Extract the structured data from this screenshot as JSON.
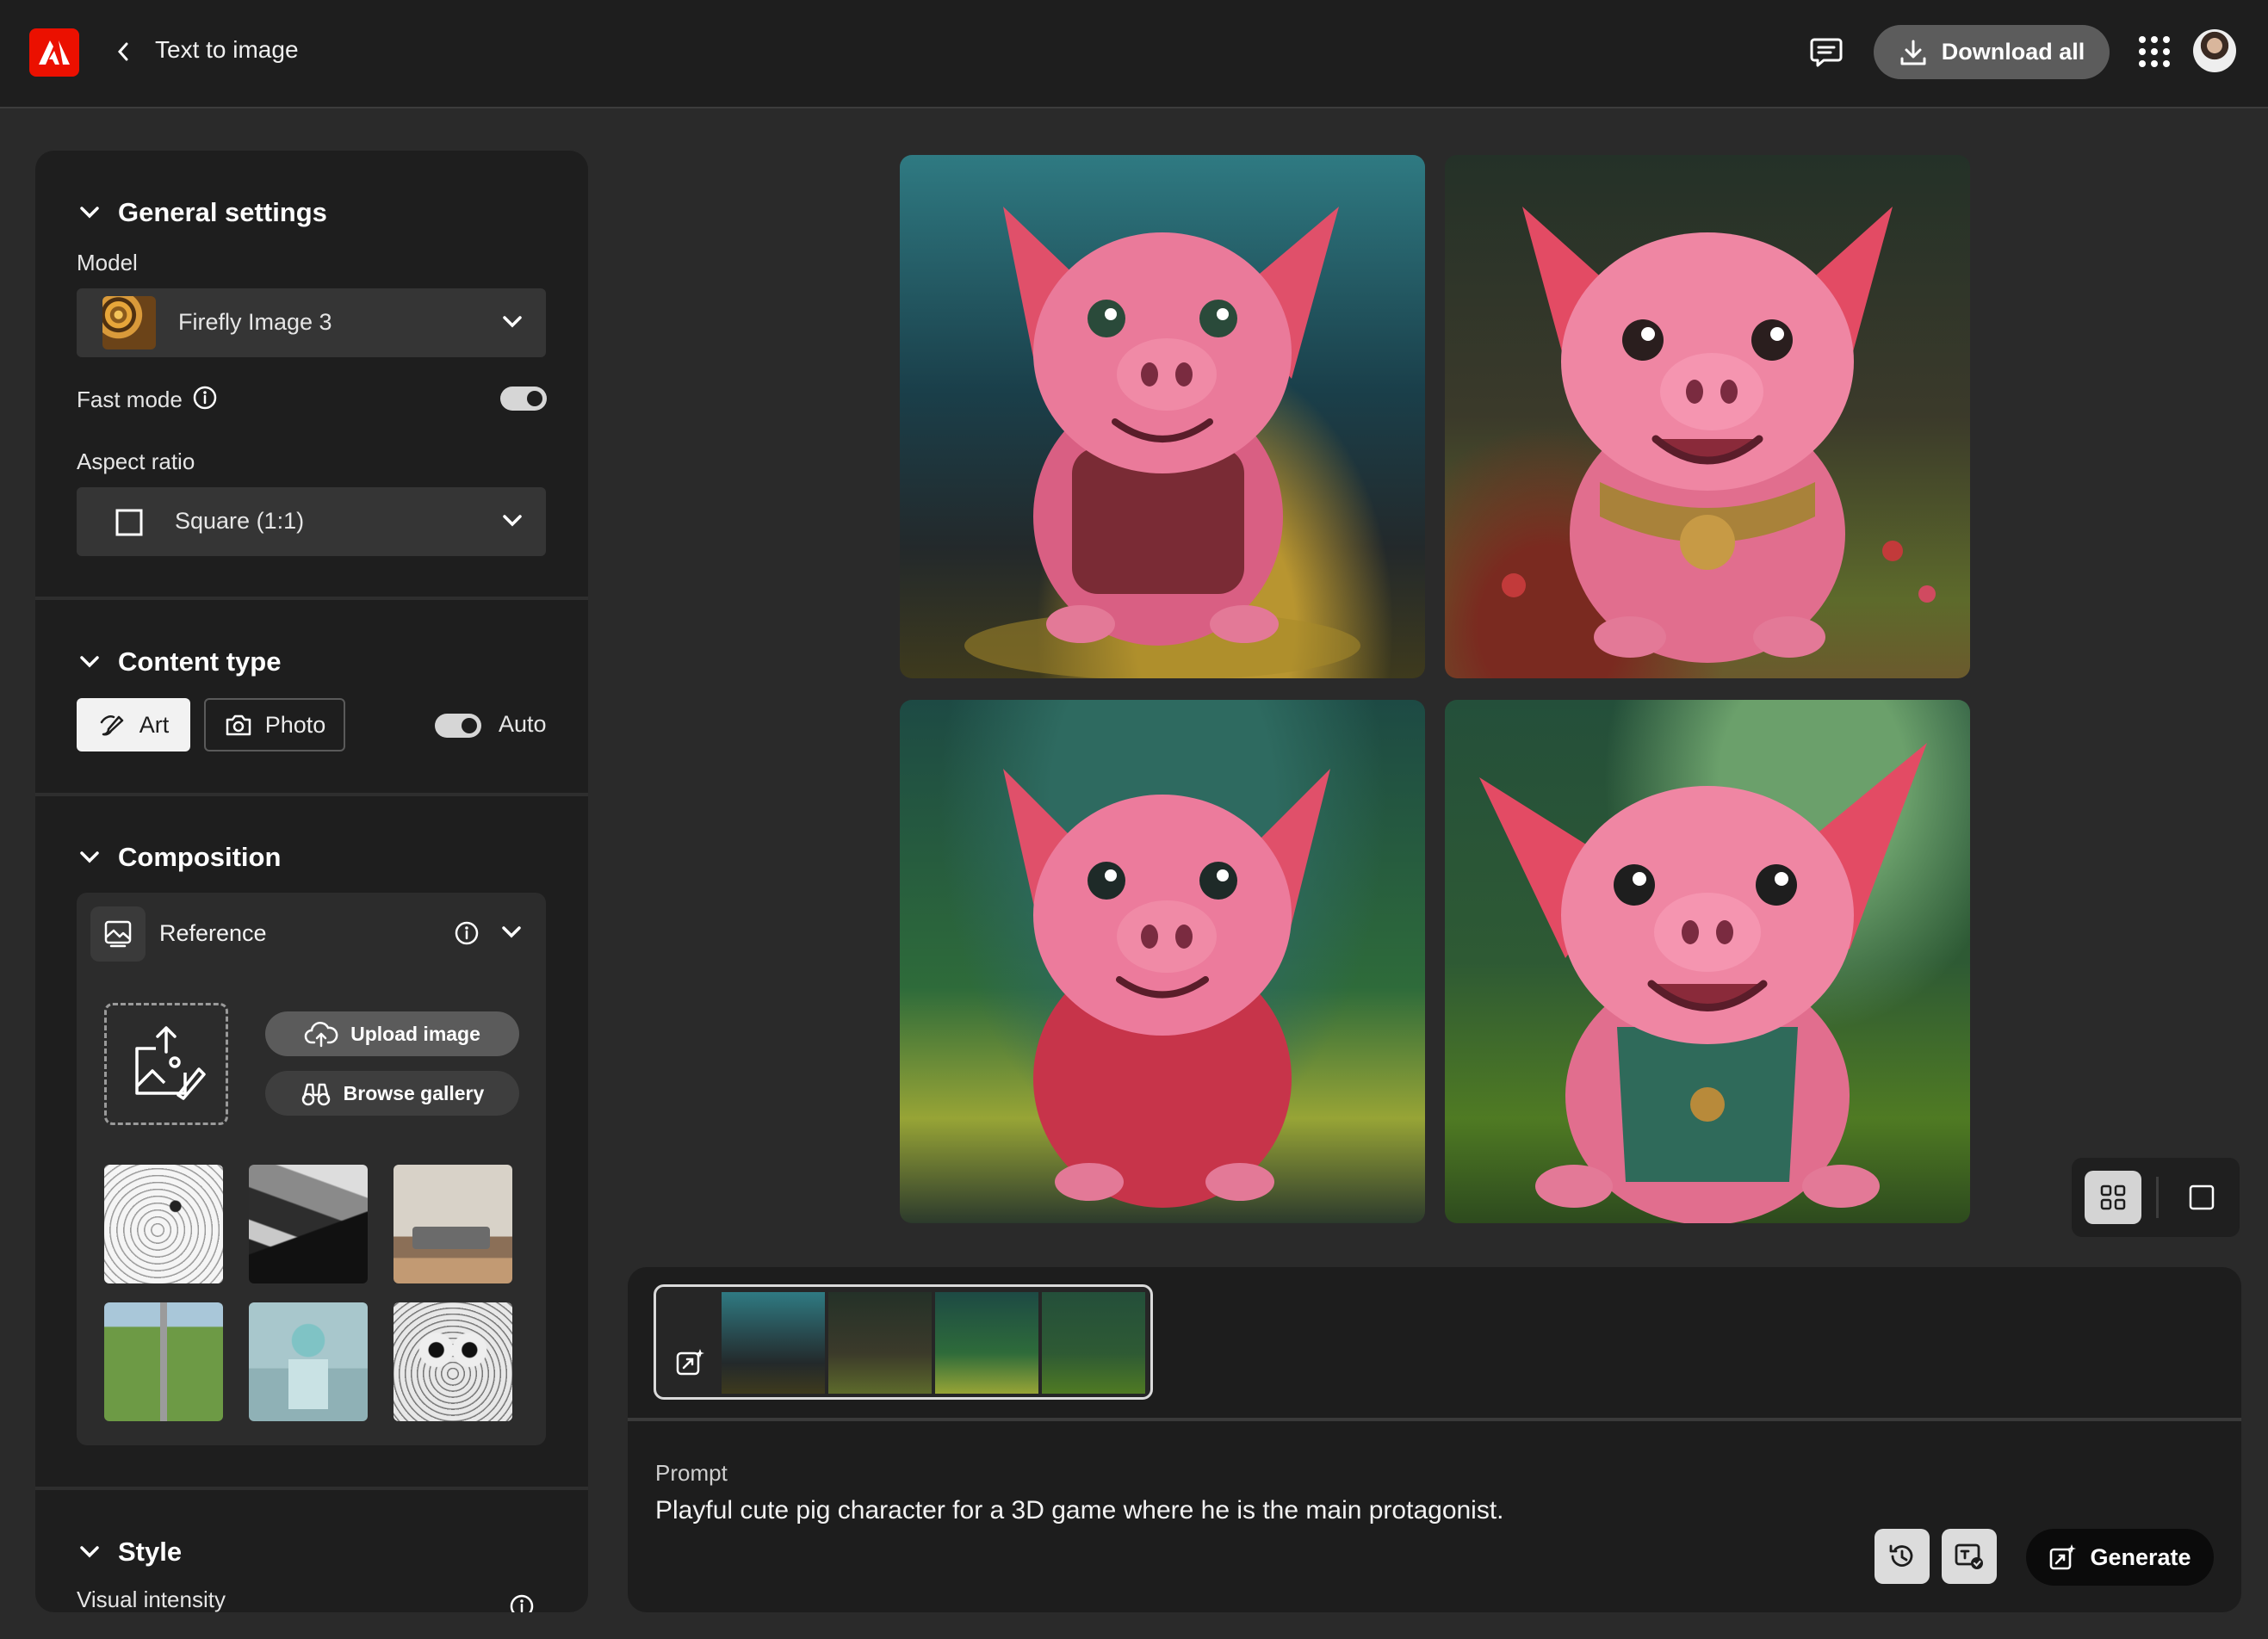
{
  "header": {
    "title": "Text to image",
    "download_label": "Download all"
  },
  "panel": {
    "general": {
      "title": "General settings",
      "model_label": "Model",
      "model_value": "Firefly Image 3",
      "fast_mode_label": "Fast mode",
      "fast_mode_on": true,
      "aspect_label": "Aspect ratio",
      "aspect_value": "Square (1:1)"
    },
    "content_type": {
      "title": "Content type",
      "art_label": "Art",
      "photo_label": "Photo",
      "auto_label": "Auto",
      "auto_on": true,
      "selected": "Art"
    },
    "composition": {
      "title": "Composition",
      "reference_label": "Reference",
      "upload_label": "Upload image",
      "browse_label": "Browse gallery"
    },
    "style": {
      "title": "Style",
      "visual_intensity_label": "Visual intensity"
    }
  },
  "view": {
    "mode": "grid"
  },
  "prompt": {
    "label": "Prompt",
    "text": "Playful cute pig character for a 3D game where he is the main protagonist.",
    "generate_label": "Generate"
  },
  "colors": {
    "brand": "#eb1000",
    "background": "#2a2a2a",
    "panel": "#1e1e1e"
  }
}
